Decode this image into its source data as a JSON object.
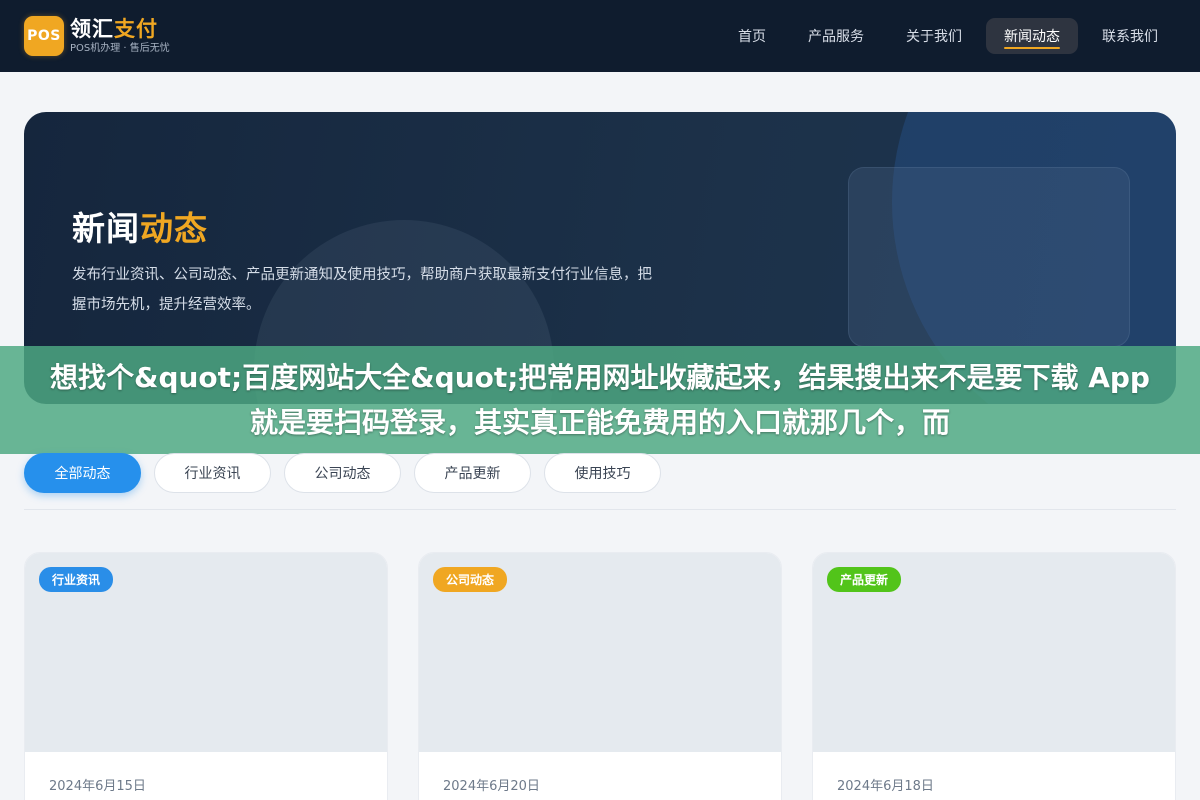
{
  "header": {
    "logo_mark": "POS",
    "logo_name_part1": "领汇",
    "logo_name_part2": "支付",
    "logo_sub": "POS机办理 · 售后无忧",
    "nav": [
      {
        "label": "首页",
        "active": false
      },
      {
        "label": "产品服务",
        "active": false
      },
      {
        "label": "关于我们",
        "active": false
      },
      {
        "label": "新闻动态",
        "active": true
      },
      {
        "label": "联系我们",
        "active": false
      }
    ]
  },
  "hero": {
    "title_part1": "新闻",
    "title_part2": "动态",
    "description": "发布行业资讯、公司动态、产品更新通知及使用技巧，帮助商户获取最新支付行业信息，把握市场先机，提升经营效率。"
  },
  "overlay": {
    "text": "想找个&quot;百度网站大全&quot;把常用网址收藏起来，结果搜出来不是要下载 App 就是要扫码登录，其实真正能免费用的入口就那几个，而"
  },
  "filters": [
    {
      "label": "全部动态",
      "active": true
    },
    {
      "label": "行业资讯",
      "active": false
    },
    {
      "label": "公司动态",
      "active": false
    },
    {
      "label": "产品更新",
      "active": false
    },
    {
      "label": "使用技巧",
      "active": false
    }
  ],
  "cards": [
    {
      "badge": "行业资讯",
      "badge_color": "#2a8ee8",
      "date": "2024年6月15日"
    },
    {
      "badge": "公司动态",
      "badge_color": "#f0a722",
      "date": "2024年6月20日"
    },
    {
      "badge": "产品更新",
      "badge_color": "#52c41a",
      "date": "2024年6月18日"
    }
  ],
  "colors": {
    "accent": "#f0a722",
    "primary_blue": "#2690ec",
    "header_bg": "#0f1c2e"
  }
}
